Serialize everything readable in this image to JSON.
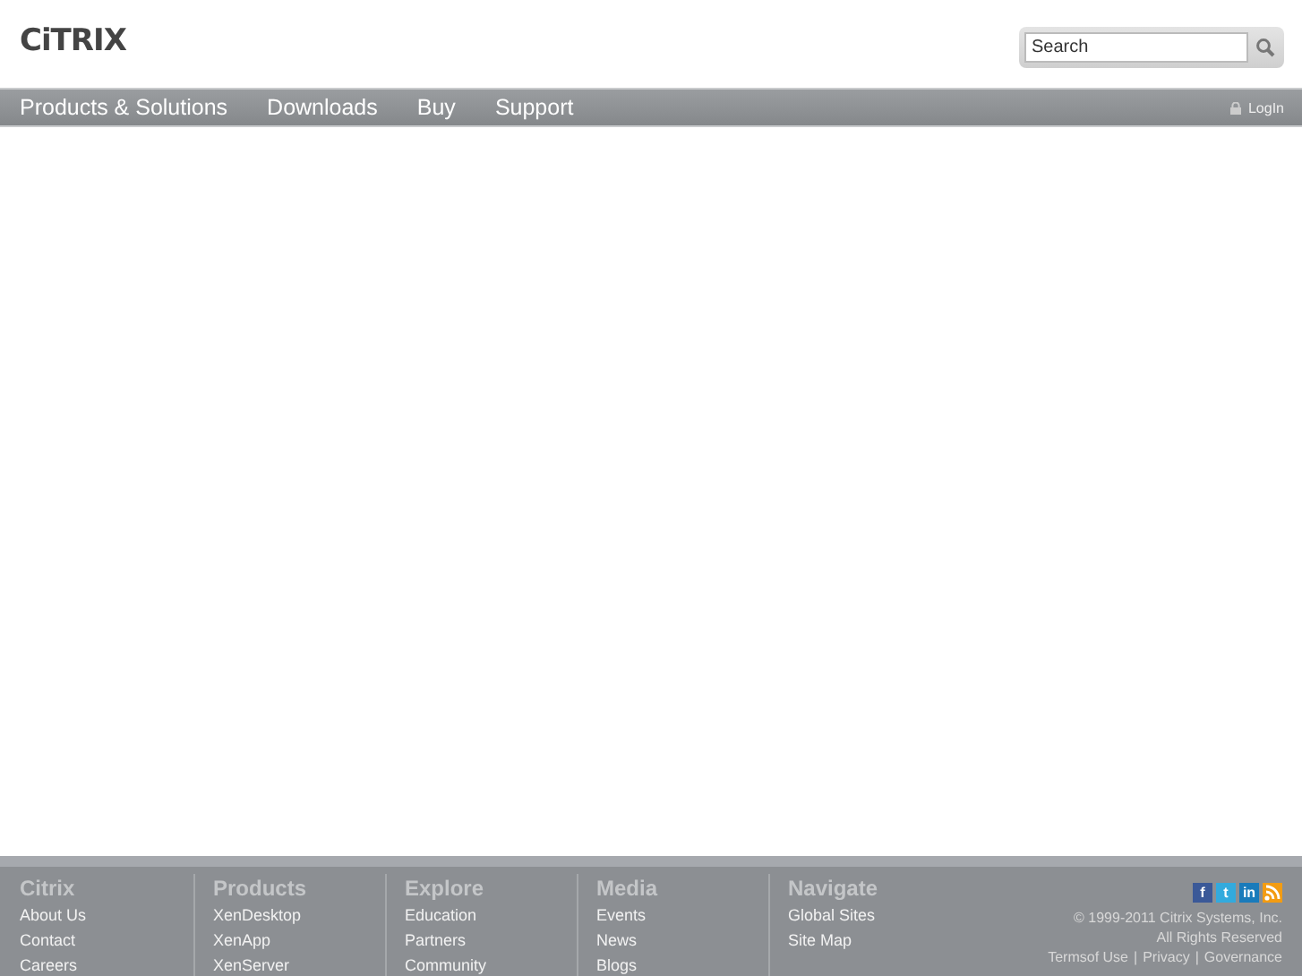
{
  "header": {
    "logo": "CiTRIX",
    "search": {
      "placeholder": "Search"
    }
  },
  "nav": {
    "items": [
      "Products & Solutions",
      "Downloads",
      "Buy",
      "Support"
    ],
    "login": "LogIn"
  },
  "footer": {
    "columns": [
      {
        "heading": "Citrix",
        "links": [
          "About Us",
          "Contact",
          "Careers"
        ]
      },
      {
        "heading": "Products",
        "links": [
          "XenDesktop",
          "XenApp",
          "XenServer"
        ]
      },
      {
        "heading": "Explore",
        "links": [
          "Education",
          "Partners",
          "Community"
        ]
      },
      {
        "heading": "Media",
        "links": [
          "Events",
          "News",
          "Blogs"
        ]
      },
      {
        "heading": "Navigate",
        "links": [
          "Global Sites",
          "Site Map"
        ]
      }
    ],
    "social": [
      {
        "kind": "facebook",
        "label": "f",
        "color": "#3b5998"
      },
      {
        "kind": "twitter",
        "label": "t",
        "color": "#33aadd"
      },
      {
        "kind": "linkedin",
        "label": "in",
        "color": "#1a7bbb"
      },
      {
        "kind": "rss",
        "color": "#f39c12"
      }
    ],
    "copyright": "© 1999-2011 Citrix Systems, Inc.",
    "rights": "All Rights Reserved",
    "legal_links": [
      "Termsof Use",
      "Privacy",
      "Governance"
    ],
    "separator": "|"
  }
}
